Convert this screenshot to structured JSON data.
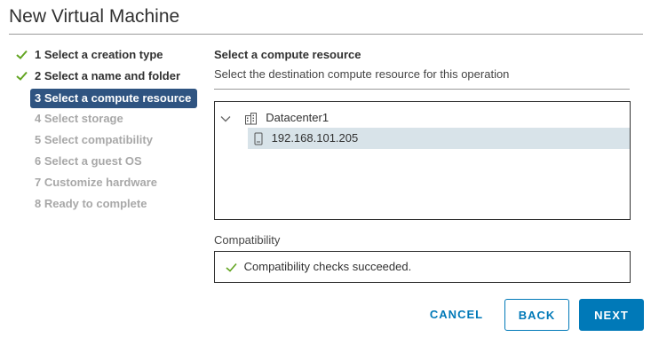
{
  "window": {
    "title": "New Virtual Machine"
  },
  "wizard": {
    "steps": [
      {
        "label": "1 Select a creation type",
        "state": "done"
      },
      {
        "label": "2 Select a name and folder",
        "state": "done"
      },
      {
        "label": "3 Select a compute resource",
        "state": "current"
      },
      {
        "label": "4 Select storage",
        "state": "todo"
      },
      {
        "label": "5 Select compatibility",
        "state": "todo"
      },
      {
        "label": "6 Select a guest OS",
        "state": "todo"
      },
      {
        "label": "7 Customize hardware",
        "state": "todo"
      },
      {
        "label": "8 Ready to complete",
        "state": "todo"
      }
    ]
  },
  "content": {
    "heading": "Select a compute resource",
    "subheading": "Select the destination compute resource for this operation",
    "tree": {
      "datacenter": {
        "label": "Datacenter1",
        "icon": "datacenter-icon",
        "expanded": true
      },
      "host": {
        "label": "192.168.101.205",
        "icon": "host-icon",
        "selected": true
      }
    },
    "compatibility": {
      "label": "Compatibility",
      "message": "Compatibility checks succeeded.",
      "status": "success"
    }
  },
  "footer": {
    "cancel_label": "CANCEL",
    "back_label": "BACK",
    "next_label": "NEXT"
  },
  "colors": {
    "accent": "#0079b8",
    "current_step_bg": "#2f5481",
    "selection_bg": "#d8e3e9",
    "check_green": "#62a420",
    "disabled_text": "#a8a8a8"
  }
}
